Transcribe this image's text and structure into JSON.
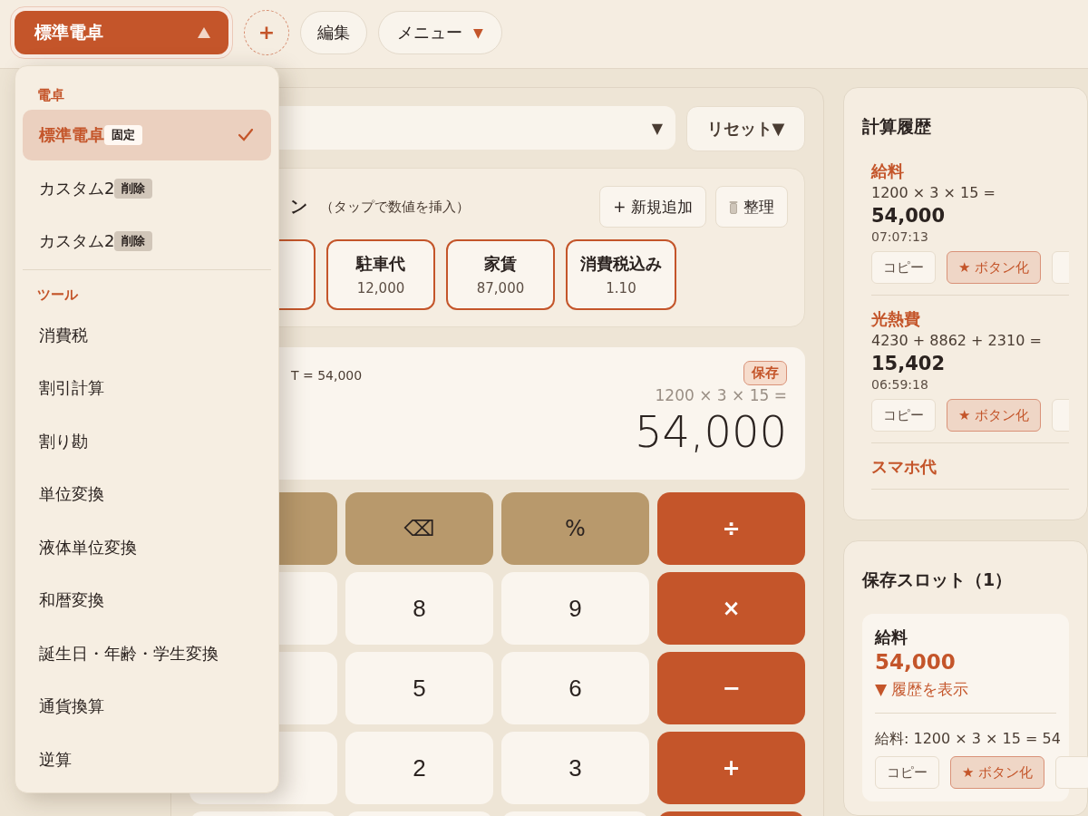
{
  "toolbar": {
    "calculator_select": {
      "label": "標準電卓",
      "expanded": true
    },
    "add_button": "+",
    "edit_button": "編集",
    "menu_button": {
      "label": "メニュー",
      "caret": "▼"
    }
  },
  "dropdown": {
    "sections": [
      {
        "heading": "電卓",
        "items": [
          {
            "label": "標準電卓",
            "badge": "固定",
            "kind": "pinned",
            "selected": true
          },
          {
            "label": "カスタム2",
            "badge": "削除",
            "kind": "deletable",
            "selected": false
          },
          {
            "label": "カスタム2",
            "badge": "削除",
            "kind": "deletable",
            "selected": false
          }
        ]
      },
      {
        "heading": "ツール",
        "items": [
          {
            "label": "消費税",
            "selected": false
          },
          {
            "label": "割引計算",
            "selected": false
          },
          {
            "label": "割り勘",
            "selected": false
          },
          {
            "label": "単位変換",
            "selected": false
          },
          {
            "label": "液体単位変換",
            "selected": false
          },
          {
            "label": "和暦変換",
            "selected": false
          },
          {
            "label": "誕生日・年齢・学生変換",
            "selected": false
          },
          {
            "label": "通貨換算",
            "selected": false
          },
          {
            "label": "逆算",
            "selected": false
          }
        ]
      }
    ]
  },
  "main": {
    "mode_select": {
      "caret": "▼"
    },
    "reset_button": "リセット▼",
    "presets": {
      "title": "ン",
      "hint": "（タップで数値を挿入）",
      "add_button": "+ 新規追加",
      "tidy_button": "整理",
      "buttons": [
        {
          "partial": true
        },
        {
          "name": "駐車代",
          "value": "12,000"
        },
        {
          "name": "家賃",
          "value": "87,000"
        },
        {
          "name": "消費税込み",
          "value": "1.10"
        }
      ]
    },
    "display": {
      "memory_line": "T = 54,000",
      "save_badge": "保存",
      "expression": "1200 × 3 × 15 =",
      "result": "54,000"
    },
    "keypad": [
      [
        {
          "kind": "function"
        },
        {
          "kind": "function",
          "label": "⌫"
        },
        {
          "kind": "function",
          "label": "%"
        },
        {
          "kind": "operator",
          "label": "÷"
        }
      ],
      [
        {
          "kind": "digit"
        },
        {
          "kind": "digit",
          "label": "8"
        },
        {
          "kind": "digit",
          "label": "9"
        },
        {
          "kind": "operator",
          "label": "×"
        }
      ],
      [
        {
          "kind": "digit"
        },
        {
          "kind": "digit",
          "label": "5"
        },
        {
          "kind": "digit",
          "label": "6"
        },
        {
          "kind": "operator",
          "label": "−"
        }
      ],
      [
        {
          "kind": "digit"
        },
        {
          "kind": "digit",
          "label": "2"
        },
        {
          "kind": "digit",
          "label": "3"
        },
        {
          "kind": "operator",
          "label": "+"
        }
      ],
      [
        {
          "kind": "digit"
        },
        {
          "kind": "digit"
        },
        {
          "kind": "digit"
        },
        {
          "kind": "operator"
        }
      ]
    ]
  },
  "history": {
    "title": "計算履歴",
    "items": [
      {
        "name": "給料",
        "expression": "1200 × 3 × 15 =",
        "result": "54,000",
        "time": "07:07:13",
        "copy_button": "コピー",
        "star_button": "★ ボタン化"
      },
      {
        "name": "光熱費",
        "expression": "4230 + 8862 + 2310 =",
        "result": "15,402",
        "time": "06:59:18",
        "copy_button": "コピー",
        "star_button": "★ ボタン化"
      },
      {
        "name": "スマホ代"
      }
    ]
  },
  "saved_slots": {
    "title": "保存スロット（1）",
    "slots": [
      {
        "name": "給料",
        "value": "54,000",
        "history_toggle": "▼ 履歴を表示",
        "entries": [
          {
            "text": "給料: 1200 × 3 × 15 = 54",
            "copy_button": "コピー",
            "star_button": "★ ボタン化"
          }
        ]
      }
    ]
  }
}
